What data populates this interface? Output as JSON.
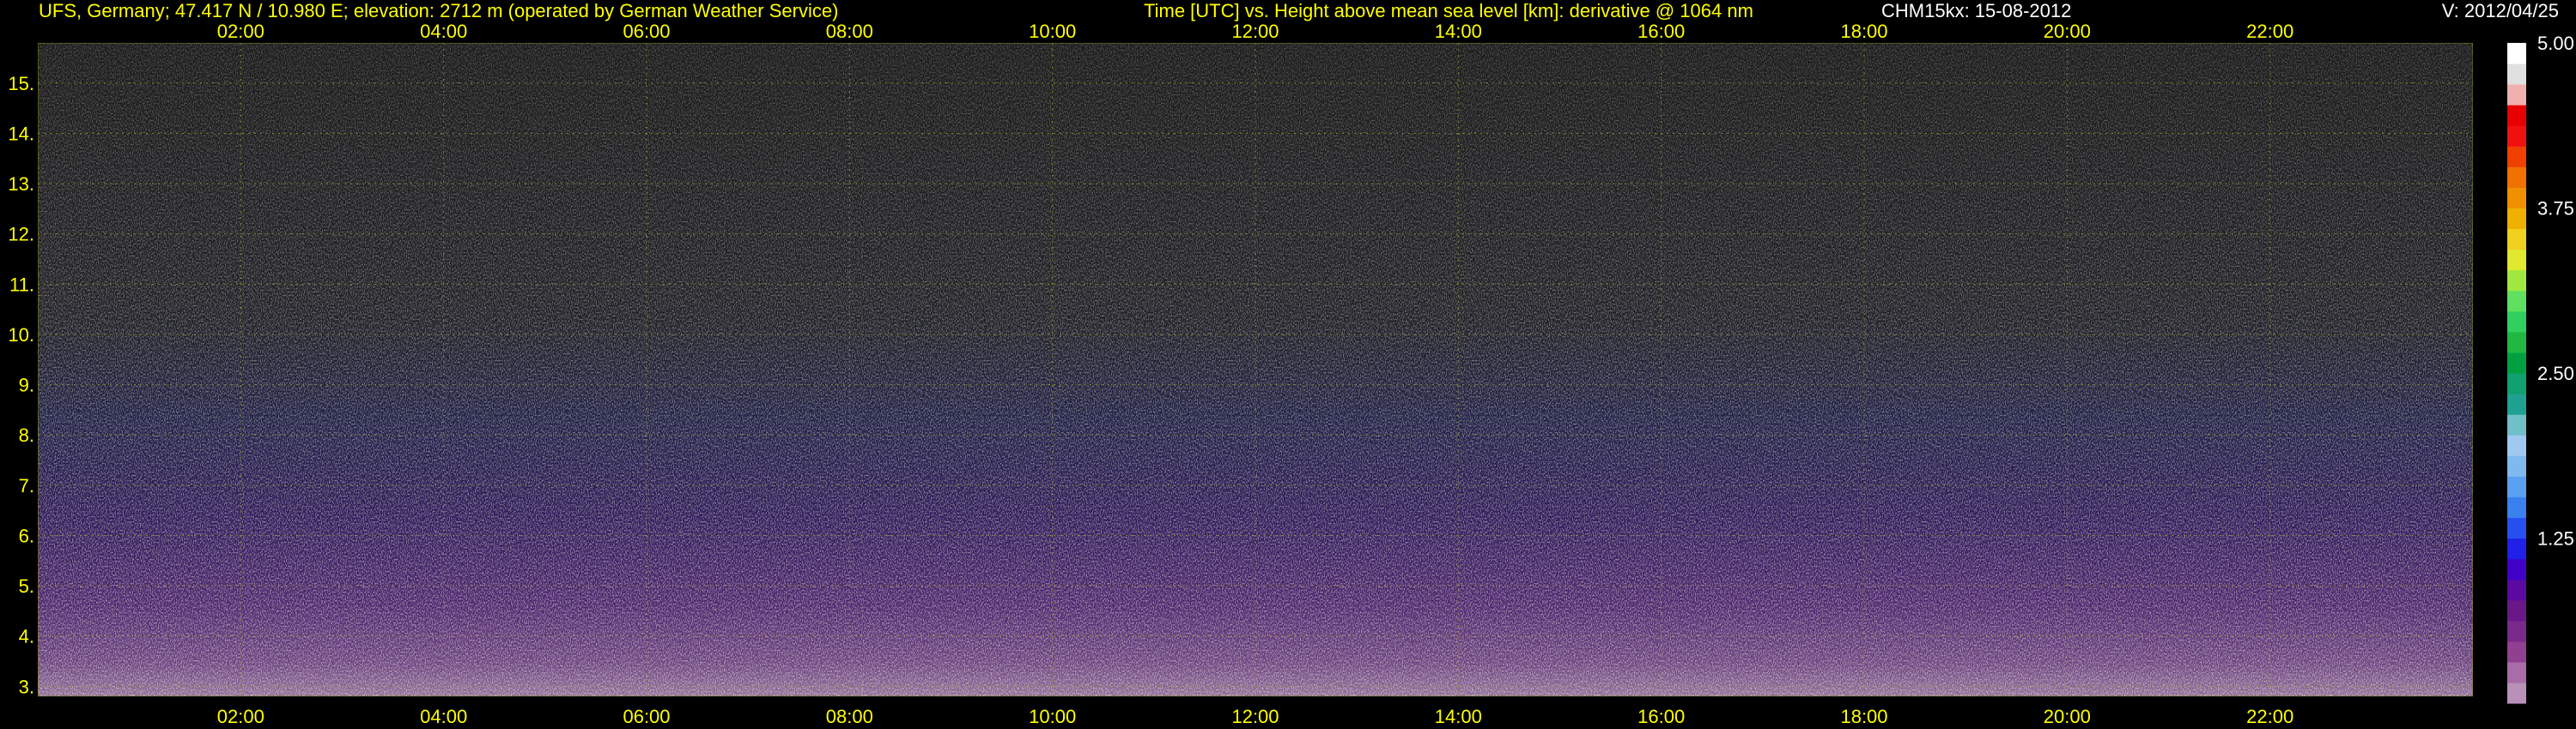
{
  "header": {
    "site": "UFS, Germany; 47.417 N / 10.980 E; elevation: 2712 m  (operated by German Weather Service)",
    "title": "Time [UTC] vs. Height above mean sea level [km]: derivative @ 1064 nm",
    "instrument": "CHM15kx: 15-08-2012",
    "version": "V: 2012/04/25"
  },
  "chart_data": {
    "type": "heatmap",
    "title": "Time [UTC] vs. Height above mean sea level [km]: derivative @ 1064 nm",
    "xlabel": "Time [UTC]",
    "ylabel": "Height above mean sea level [km]",
    "x_ticks": [
      "02:00",
      "04:00",
      "06:00",
      "08:00",
      "10:00",
      "12:00",
      "14:00",
      "16:00",
      "18:00",
      "20:00",
      "22:00"
    ],
    "y_ticks": [
      "3.",
      "4.",
      "5.",
      "6.",
      "7.",
      "8.",
      "9.",
      "10.",
      "11.",
      "12.",
      "13.",
      "14.",
      "15."
    ],
    "xlim": [
      "00:00",
      "24:00"
    ],
    "ylim": [
      2.8,
      15.8
    ],
    "grid": true,
    "colorbar": {
      "range": [
        0,
        5
      ],
      "tick_labels": [
        "1.25",
        "2.50",
        "3.75",
        "5.00"
      ],
      "colors": [
        "#b890b8",
        "#a86ca8",
        "#904090",
        "#7a2a8a",
        "#6a1888",
        "#5a0aa0",
        "#4000c8",
        "#2020e8",
        "#2850f0",
        "#3a80ee",
        "#5aa0f0",
        "#80b8f0",
        "#a0c8f0",
        "#70c0c8",
        "#20a090",
        "#10a070",
        "#00a040",
        "#20b840",
        "#30d060",
        "#60e060",
        "#a0e840",
        "#e0e830",
        "#f0d020",
        "#f0b000",
        "#f09000",
        "#f07000",
        "#f04000",
        "#f01010",
        "#e80000",
        "#f0b0b0",
        "#e0e0e0",
        "#ffffff"
      ]
    }
  }
}
